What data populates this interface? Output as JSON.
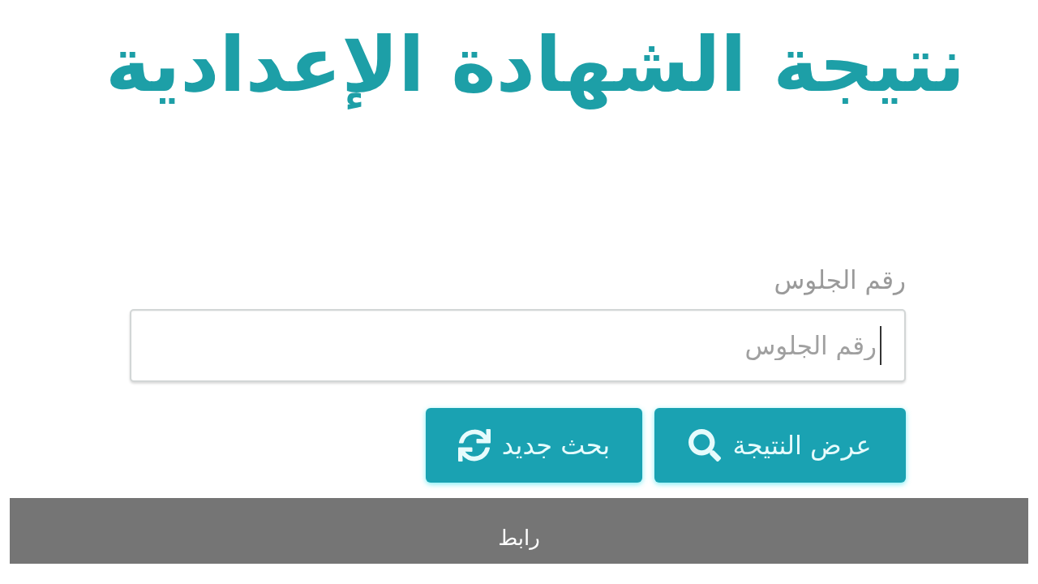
{
  "title": "نتيجة الشهادة الإعدادية",
  "form": {
    "label": "رقم الجلوس",
    "field": {
      "placeholder": "رقم الجلوس",
      "focused": true
    }
  },
  "buttons": [
    {
      "kind": "search",
      "label": "عرض النتيجة"
    },
    {
      "kind": "reset",
      "label": "بحث جديد"
    }
  ],
  "link_bar": {
    "label": "رابط"
  }
}
